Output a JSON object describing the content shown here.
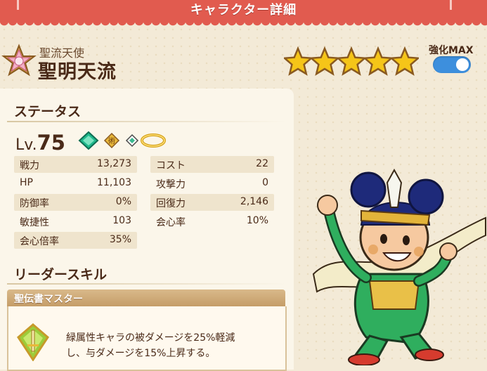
{
  "header": {
    "title": "キャラクター詳細"
  },
  "character": {
    "title": "聖流天使",
    "name": "聖明天流",
    "stars": 5,
    "enhance_label": "強化MAX",
    "enhance_on": true
  },
  "status": {
    "heading": "ステータス",
    "level_label": "Lv.",
    "level": "75",
    "rows": [
      {
        "label": "戦力",
        "value": "13,273"
      },
      {
        "label": "HP",
        "value": "11,103"
      },
      {
        "label": "防御率",
        "value": "0%"
      },
      {
        "label": "敏捷性",
        "value": "103"
      },
      {
        "label": "会心倍率",
        "value": "35%"
      },
      {
        "label": "コスト",
        "value": "22"
      },
      {
        "label": "攻撃力",
        "value": "0"
      },
      {
        "label": "回復力",
        "value": "2,146"
      },
      {
        "label": "会心率",
        "value": "10%"
      }
    ]
  },
  "leader_skill": {
    "heading": "リーダースキル",
    "name": "聖伝書マスター",
    "desc_line1": "緑属性キャラの被ダメージを25%軽減",
    "desc_line2": "し、与ダメージを15%上昇する。"
  },
  "colors": {
    "header": "#e15b4f",
    "toggle": "#3d8fdd",
    "star": "#f5c518"
  }
}
